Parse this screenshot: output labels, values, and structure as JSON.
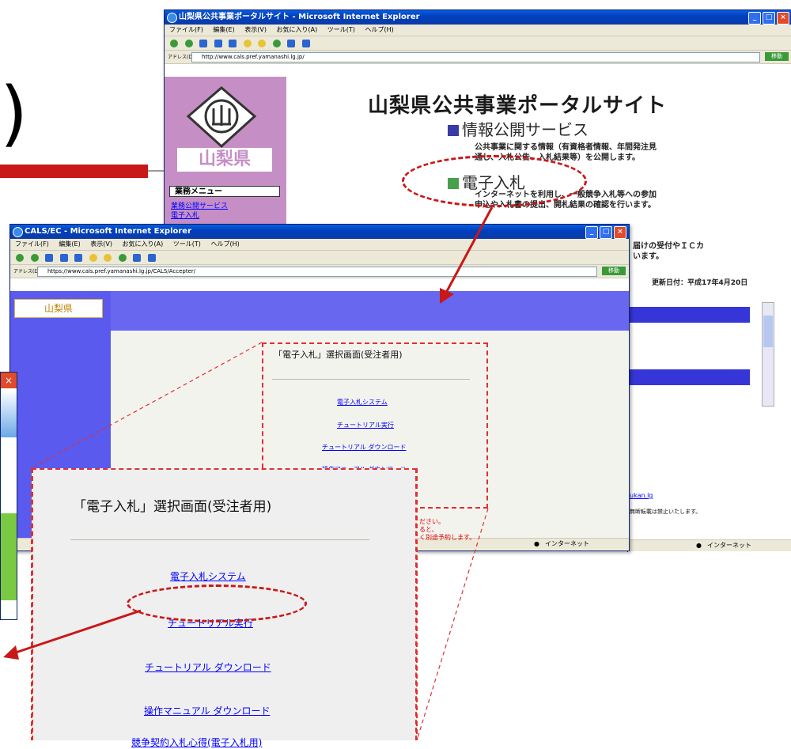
{
  "colors": {
    "accent_red": "#c81818",
    "portal_side": "#c58fc6",
    "cals_nav": "#5a5aef",
    "link": "#0000ff"
  },
  "portal": {
    "window_title": "山梨県公共事業ポータルサイト - Microsoft Internet Explorer",
    "menu": [
      "ファイル(F)",
      "編集(E)",
      "表示(V)",
      "お気に入り(A)",
      "ツール(T)",
      "ヘルプ(H)"
    ],
    "address_label": "アドレス(D)",
    "address": "http://www.cals.pref.yamanashi.lg.jp/",
    "go_label": "移動",
    "logo_text": "山梨県",
    "menu_head": "業務メニュー",
    "menu_links": [
      "業務公開サービス",
      "電子入札"
    ],
    "title": "山梨県公共事業ポータルサイト",
    "section1": "情報公開サービス",
    "section1_desc": [
      "公共事業に関する情報（有資格者情報、年間発注見",
      "通し、入札公告、入札結果等）を公開します。"
    ],
    "section2": "電子入札",
    "section2_desc": [
      "インターネットを利用し、一般競争入札等への参加",
      "申込や入札書の提出、開札結果の確認を行います。"
    ],
    "section3_desc": [
      "届けの受付やＩＣカ",
      "います。"
    ],
    "updated": "更新日付：平成17年4月20日",
    "footer_link": "ukan.lg",
    "footer_text": "無断転載は禁止いたします。",
    "status_zone": "インターネット"
  },
  "cals": {
    "window_title": "CALS/EC - Microsoft Internet Explorer",
    "menu": [
      "ファイル(F)",
      "編集(E)",
      "表示(V)",
      "お気に入り(A)",
      "ツール(T)",
      "ヘルプ(H)"
    ],
    "address_label": "アドレス(D)",
    "address": "https://www.cals.pref.yamanashi.lg.jp/CALS/Accepter/",
    "go_label": "移動",
    "logo_text": "山梨県",
    "page_title": "「電子入札」選択画面(受注者用)",
    "links": [
      "電子入札システム",
      "チュートリアル実行",
      "チュートリアル ダウンロード",
      "操作マニュアル ダウンロード"
    ],
    "red_note": [
      "ださい。",
      "ると、",
      "く別途予約します。"
    ],
    "status_zone": "インターネット"
  },
  "zoom": {
    "title": "「電子入札」選択画面(受注者用)",
    "links": [
      "電子入札システム",
      "チュートリアル実行",
      "チュートリアル ダウンロード",
      "操作マニュアル ダウンロード",
      "競争契約入札心得(電子入札用)"
    ]
  },
  "left_window": {
    "close": "×"
  }
}
